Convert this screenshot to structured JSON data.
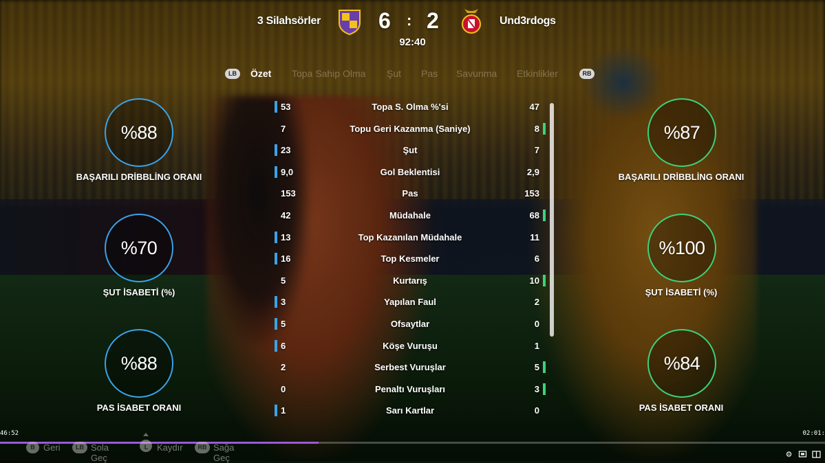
{
  "match": {
    "home_team": "3 Silahsörler",
    "away_team": "Und3rdogs",
    "home_score": "6",
    "away_score": "2",
    "separator": ":",
    "clock": "92:40",
    "home_color": "#3aa3e8",
    "away_color": "#3dd27a"
  },
  "tabs": {
    "lb": "LB",
    "rb": "RB",
    "items": [
      "Özet",
      "Topa Sahip Olma",
      "Şut",
      "Pas",
      "Savunma",
      "Etkinlikler"
    ],
    "active_index": 0
  },
  "rings": {
    "home": [
      {
        "value": "%88",
        "label": "BAŞARILI DRİBBLİNG ORANI"
      },
      {
        "value": "%70",
        "label": "ŞUT İSABETİ (%)"
      },
      {
        "value": "%88",
        "label": "PAS İSABET ORANI"
      }
    ],
    "away": [
      {
        "value": "%87",
        "label": "BAŞARILI DRİBBLİNG ORANI"
      },
      {
        "value": "%100",
        "label": "ŞUT İSABETİ (%)"
      },
      {
        "value": "%84",
        "label": "PAS İSABET ORANI"
      }
    ]
  },
  "stats": [
    {
      "name": "Topa S. Olma %'si",
      "home": "53",
      "away": "47",
      "lead": "home"
    },
    {
      "name": "Topu Geri Kazanma (Saniye)",
      "home": "7",
      "away": "8",
      "lead": "away"
    },
    {
      "name": "Şut",
      "home": "23",
      "away": "7",
      "lead": "home"
    },
    {
      "name": "Gol Beklentisi",
      "home": "9,0",
      "away": "2,9",
      "lead": "home"
    },
    {
      "name": "Pas",
      "home": "153",
      "away": "153",
      "lead": "none"
    },
    {
      "name": "Müdahale",
      "home": "42",
      "away": "68",
      "lead": "away"
    },
    {
      "name": "Top Kazanılan Müdahale",
      "home": "13",
      "away": "11",
      "lead": "home"
    },
    {
      "name": "Top Kesmeler",
      "home": "16",
      "away": "6",
      "lead": "home"
    },
    {
      "name": "Kurtarış",
      "home": "5",
      "away": "10",
      "lead": "away"
    },
    {
      "name": "Yapılan Faul",
      "home": "3",
      "away": "2",
      "lead": "home"
    },
    {
      "name": "Ofsaytlar",
      "home": "5",
      "away": "0",
      "lead": "home"
    },
    {
      "name": "Köşe Vuruşu",
      "home": "6",
      "away": "1",
      "lead": "home"
    },
    {
      "name": "Serbest Vuruşlar",
      "home": "2",
      "away": "5",
      "lead": "away"
    },
    {
      "name": "Penaltı Vuruşları",
      "home": "0",
      "away": "3",
      "lead": "away"
    },
    {
      "name": "Sarı Kartlar",
      "home": "1",
      "away": "0",
      "lead": "home"
    }
  ],
  "footer": {
    "back_key": "B",
    "back_label": "Geri",
    "left_key": "LB",
    "left_label": "Sola Geç",
    "scroll_key": "L",
    "scroll_label": "Kaydır",
    "right_key": "RB",
    "right_label": "Sağa Geç"
  },
  "video": {
    "elapsed": "46:52",
    "remaining": "02:01:",
    "progress_fraction": 0.386,
    "accent": "#9b59d8",
    "icons": [
      "settings-icon",
      "cast-icon",
      "theater-mode-icon"
    ]
  }
}
